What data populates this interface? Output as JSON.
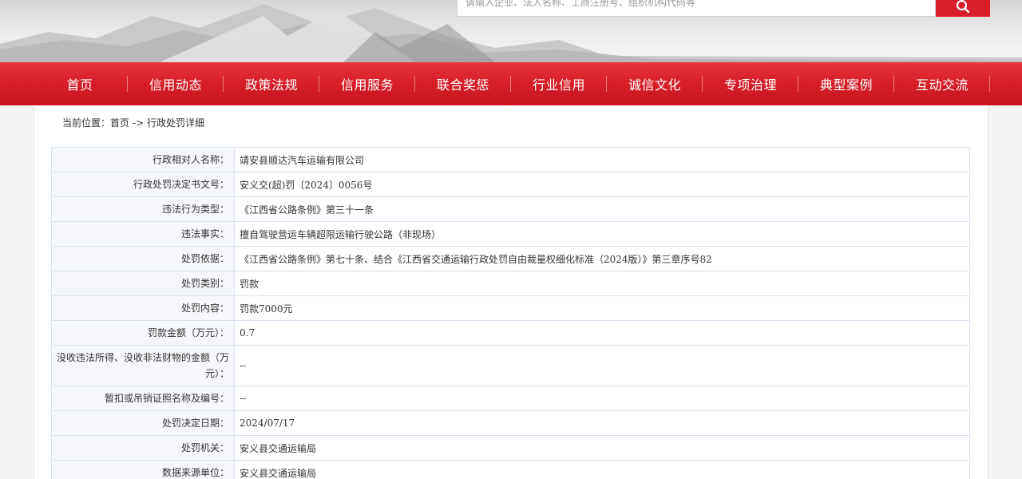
{
  "search": {
    "text": "请输入企业、法人名称、工商注册号、组织机构代码等"
  },
  "nav": {
    "items": [
      {
        "label": "首页"
      },
      {
        "label": "信用动态"
      },
      {
        "label": "政策法规"
      },
      {
        "label": "信用服务"
      },
      {
        "label": "联合奖惩"
      },
      {
        "label": "行业信用"
      },
      {
        "label": "诚信文化"
      },
      {
        "label": "专项治理"
      },
      {
        "label": "典型案例"
      },
      {
        "label": "互动交流"
      }
    ]
  },
  "breadcrumb": {
    "prefix": "当前位置：",
    "home": "首页",
    "sep": " -> ",
    "current": "行政处罚详细"
  },
  "details": [
    {
      "label": "行政相对人名称：",
      "value": "靖安县顺达汽车运输有限公司"
    },
    {
      "label": "行政处罚决定书文号：",
      "value": "安义交(超)罚〔2024〕0056号"
    },
    {
      "label": "违法行为类型：",
      "value": "《江西省公路条例》第三十一条"
    },
    {
      "label": "违法事实：",
      "value": "擅自驾驶营运车辆超限运输行驶公路（非现场）"
    },
    {
      "label": "处罚依据：",
      "value": "《江西省公路条例》第七十条、结合《江西省交通运输行政处罚自由裁量权细化标准（2024版）》第三章序号82"
    },
    {
      "label": "处罚类别：",
      "value": "罚款"
    },
    {
      "label": "处罚内容：",
      "value": "罚款7000元"
    },
    {
      "label": "罚款金额（万元）：",
      "value": "0.7"
    },
    {
      "label": "没收违法所得、没收非法财物的金额（万元）：",
      "value": "--"
    },
    {
      "label": "暂扣或吊销证照名称及编号：",
      "value": "--"
    },
    {
      "label": "处罚决定日期：",
      "value": "2024/07/17"
    },
    {
      "label": "处罚机关：",
      "value": "安义县交通运输局"
    },
    {
      "label": "数据来源单位：",
      "value": "安义县交通运输局"
    }
  ],
  "colors": {
    "nav_red": "#d91f28",
    "table_border": "#d6e3f2",
    "label_bg": "#f5f7fa"
  }
}
